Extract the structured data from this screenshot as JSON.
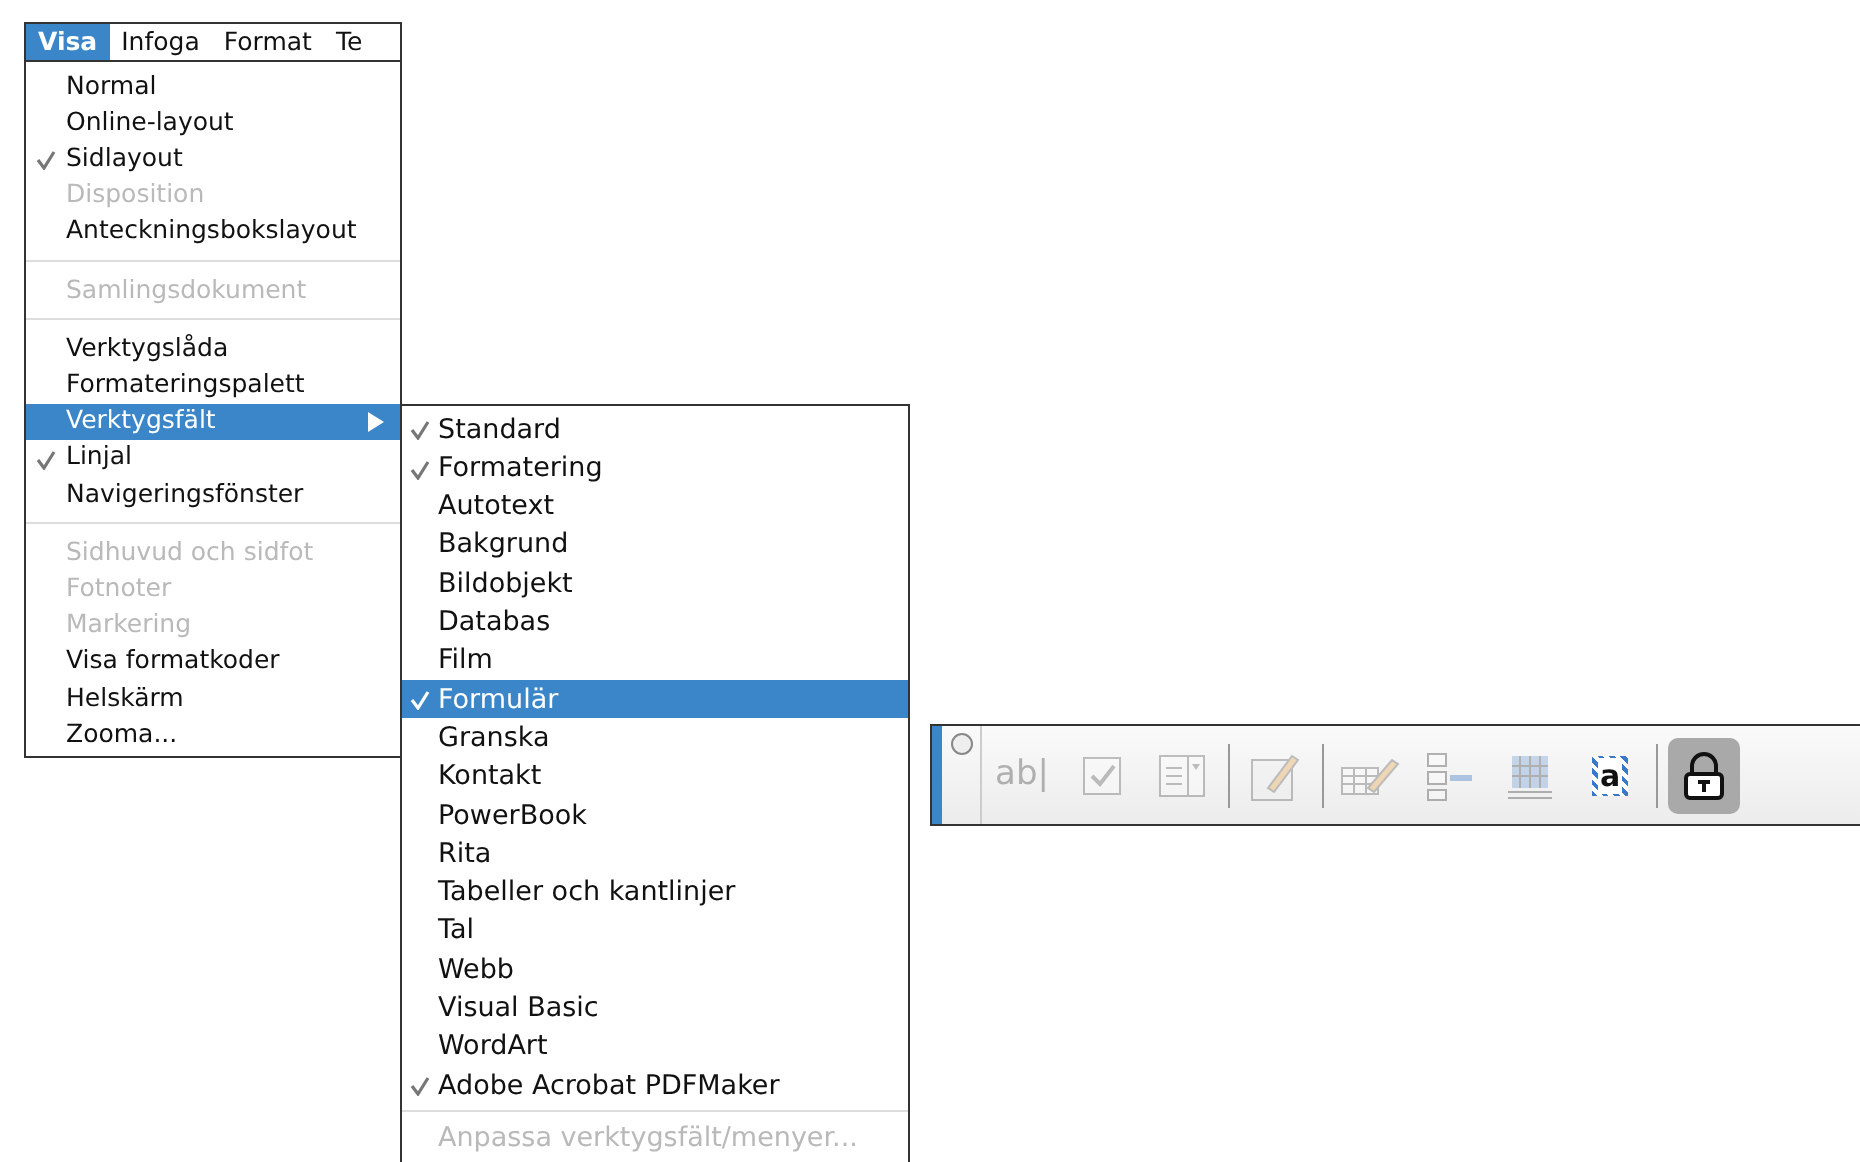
{
  "menu_bar": [
    {
      "label": "Visa",
      "selected": true
    },
    {
      "label": "Infoga",
      "selected": false
    },
    {
      "label": "Format",
      "selected": false
    },
    {
      "label": "Te",
      "selected": false
    }
  ],
  "menu": {
    "items": [
      {
        "kind": "item",
        "label": "Normal",
        "checked": false,
        "disabled": false,
        "selected": false
      },
      {
        "kind": "item",
        "label": "Online-layout",
        "checked": false,
        "disabled": false,
        "selected": false
      },
      {
        "kind": "item",
        "label": "Sidlayout",
        "checked": true,
        "disabled": false,
        "selected": false
      },
      {
        "kind": "item",
        "label": "Disposition",
        "checked": false,
        "disabled": true,
        "selected": false
      },
      {
        "kind": "item",
        "label": "Anteckningsbokslayout",
        "checked": false,
        "disabled": false,
        "selected": false
      },
      {
        "kind": "separator"
      },
      {
        "kind": "item",
        "label": "Samlingsdokument",
        "checked": false,
        "disabled": true,
        "selected": false
      },
      {
        "kind": "separator"
      },
      {
        "kind": "item",
        "label": "Verktygslåda",
        "checked": false,
        "disabled": false,
        "selected": false
      },
      {
        "kind": "item",
        "label": "Formateringspalett",
        "checked": false,
        "disabled": false,
        "selected": false
      },
      {
        "kind": "submenu",
        "label": "Verktygsfält",
        "checked": false,
        "disabled": false,
        "selected": true
      },
      {
        "kind": "item",
        "label": "Linjal",
        "checked": true,
        "disabled": false,
        "selected": false
      },
      {
        "kind": "item",
        "label": "Navigeringsfönster",
        "checked": false,
        "disabled": false,
        "selected": false
      },
      {
        "kind": "separator"
      },
      {
        "kind": "item",
        "label": "Sidhuvud och sidfot",
        "checked": false,
        "disabled": true,
        "selected": false
      },
      {
        "kind": "item",
        "label": "Fotnoter",
        "checked": false,
        "disabled": true,
        "selected": false
      },
      {
        "kind": "item",
        "label": "Markering",
        "checked": false,
        "disabled": true,
        "selected": false
      },
      {
        "kind": "item",
        "label": "Visa formatkoder",
        "checked": false,
        "disabled": false,
        "selected": false
      },
      {
        "kind": "item",
        "label": "Helskärm",
        "checked": false,
        "disabled": false,
        "selected": false
      },
      {
        "kind": "item",
        "label": "Zooma...",
        "checked": false,
        "disabled": false,
        "selected": false
      }
    ]
  },
  "submenu": {
    "items": [
      {
        "kind": "item",
        "label": "Standard",
        "checked": true,
        "disabled": false,
        "selected": false
      },
      {
        "kind": "item",
        "label": "Formatering",
        "checked": true,
        "disabled": false,
        "selected": false
      },
      {
        "kind": "item",
        "label": "Autotext",
        "checked": false,
        "disabled": false,
        "selected": false
      },
      {
        "kind": "item",
        "label": "Bakgrund",
        "checked": false,
        "disabled": false,
        "selected": false
      },
      {
        "kind": "item",
        "label": "Bildobjekt",
        "checked": false,
        "disabled": false,
        "selected": false
      },
      {
        "kind": "item",
        "label": "Databas",
        "checked": false,
        "disabled": false,
        "selected": false
      },
      {
        "kind": "item",
        "label": "Film",
        "checked": false,
        "disabled": false,
        "selected": false
      },
      {
        "kind": "item",
        "label": "Formulär",
        "checked": true,
        "disabled": false,
        "selected": true
      },
      {
        "kind": "item",
        "label": "Granska",
        "checked": false,
        "disabled": false,
        "selected": false
      },
      {
        "kind": "item",
        "label": "Kontakt",
        "checked": false,
        "disabled": false,
        "selected": false
      },
      {
        "kind": "item",
        "label": "PowerBook",
        "checked": false,
        "disabled": false,
        "selected": false
      },
      {
        "kind": "item",
        "label": "Rita",
        "checked": false,
        "disabled": false,
        "selected": false
      },
      {
        "kind": "item",
        "label": "Tabeller och kantlinjer",
        "checked": false,
        "disabled": false,
        "selected": false
      },
      {
        "kind": "item",
        "label": "Tal",
        "checked": false,
        "disabled": false,
        "selected": false
      },
      {
        "kind": "item",
        "label": "Webb",
        "checked": false,
        "disabled": false,
        "selected": false
      },
      {
        "kind": "item",
        "label": "Visual Basic",
        "checked": false,
        "disabled": false,
        "selected": false
      },
      {
        "kind": "item",
        "label": "WordArt",
        "checked": false,
        "disabled": false,
        "selected": false
      },
      {
        "kind": "item",
        "label": "Adobe Acrobat PDFMaker",
        "checked": true,
        "disabled": false,
        "selected": false
      },
      {
        "kind": "separator"
      },
      {
        "kind": "item",
        "label": "Anpassa verktygsfält/menyer...",
        "checked": false,
        "disabled": true,
        "selected": false
      }
    ]
  },
  "toolbar": {
    "items": [
      {
        "kind": "close"
      },
      {
        "kind": "text",
        "label": "ab|",
        "disabled": true,
        "pressed": false
      },
      {
        "kind": "checkbox",
        "disabled": true,
        "pressed": false
      },
      {
        "kind": "combo",
        "disabled": true,
        "pressed": false
      },
      {
        "kind": "separator"
      },
      {
        "kind": "pencil-box",
        "disabled": true,
        "pressed": false
      },
      {
        "kind": "separator"
      },
      {
        "kind": "table-pencil",
        "disabled": true,
        "pressed": false
      },
      {
        "kind": "frame",
        "disabled": true,
        "pressed": false
      },
      {
        "kind": "shading",
        "disabled": true,
        "pressed": false
      },
      {
        "kind": "letter",
        "label": "a",
        "disabled": false,
        "pressed": false
      },
      {
        "kind": "separator"
      },
      {
        "kind": "lock",
        "disabled": false,
        "pressed": true
      }
    ]
  }
}
